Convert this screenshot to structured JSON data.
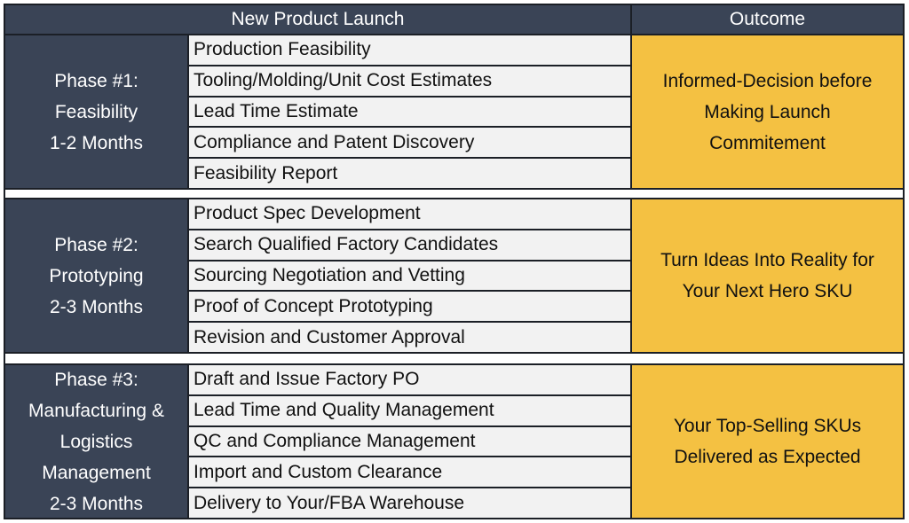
{
  "header": {
    "main_title": "New Product Launch",
    "outcome_title": "Outcome"
  },
  "colors": {
    "header_bg": "#3a4456",
    "phase_bg": "#3a4456",
    "outcome_bg": "#f4c142",
    "task_bg": "#f2f2f2"
  },
  "phases": [
    {
      "label_lines": [
        "Phase #1:",
        "Feasibility",
        "1-2 Months"
      ],
      "tasks": [
        "Production Feasibility",
        "Tooling/Molding/Unit Cost Estimates",
        "Lead Time Estimate",
        "Compliance and Patent Discovery",
        "Feasibility Report"
      ],
      "outcome_lines": [
        "Informed-Decision before",
        "Making Launch",
        "Commitement"
      ]
    },
    {
      "label_lines": [
        "Phase #2:",
        "Prototyping",
        "2-3 Months"
      ],
      "tasks": [
        "Product Spec Development",
        "Search Qualified Factory Candidates",
        "Sourcing Negotiation and Vetting",
        "Proof of Concept Prototyping",
        "Revision and Customer Approval"
      ],
      "outcome_lines": [
        "Turn Ideas Into Reality for",
        "Your Next Hero SKU"
      ]
    },
    {
      "label_lines": [
        "Phase #3:",
        "Manufacturing &",
        "Logistics",
        "Management",
        "2-3 Months"
      ],
      "tasks": [
        "Draft and Issue Factory PO",
        "Lead Time and Quality Management",
        "QC and Compliance Management",
        "Import and Custom Clearance",
        "Delivery to Your/FBA Warehouse"
      ],
      "outcome_lines": [
        "Your Top-Selling SKUs",
        "Delivered as Expected"
      ]
    }
  ]
}
